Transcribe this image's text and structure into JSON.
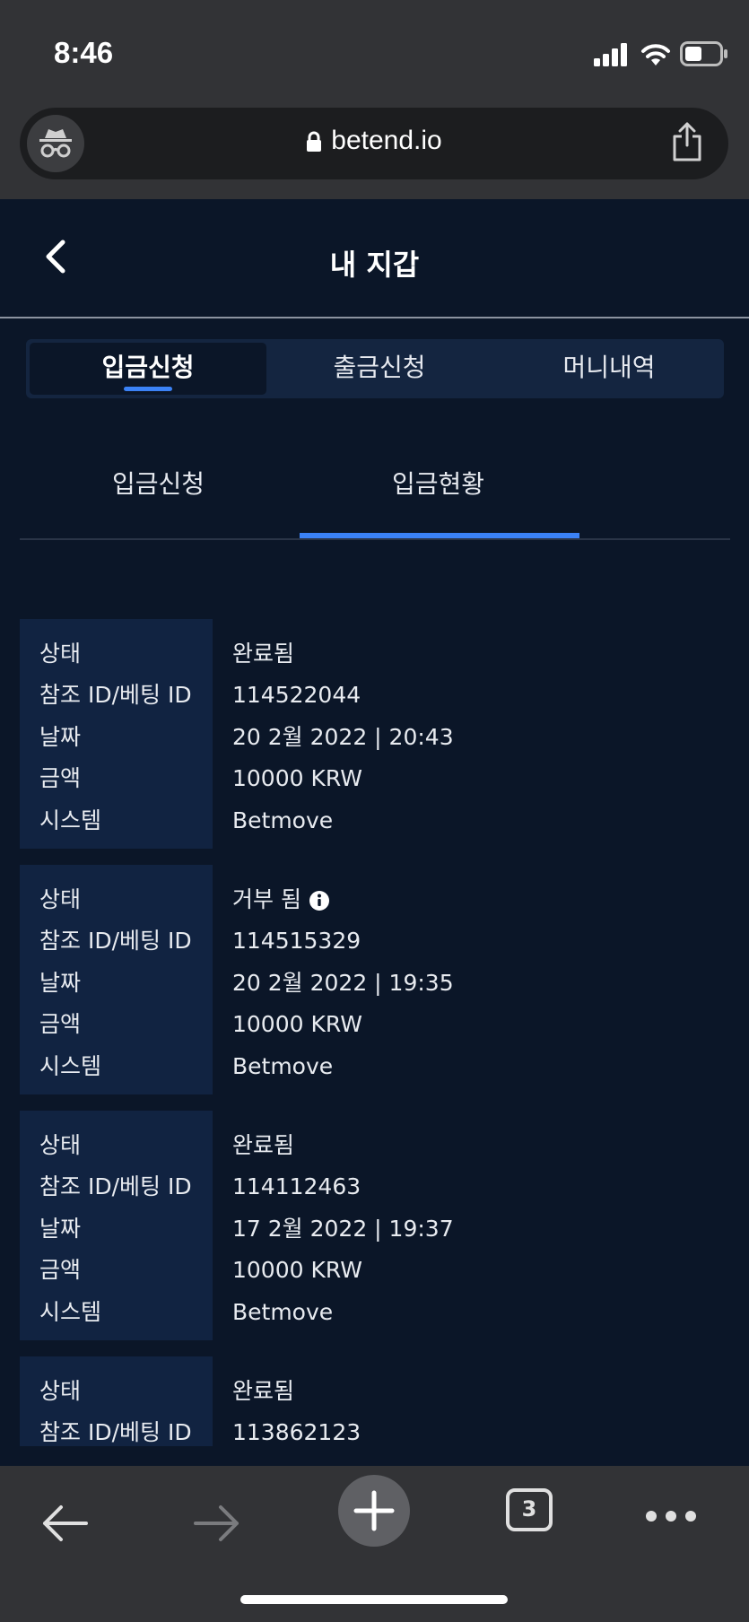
{
  "status_bar": {
    "time": "8:46"
  },
  "browser": {
    "url": "betend.io",
    "tab_count": "3"
  },
  "header": {
    "title": "내 지갑"
  },
  "tabs": [
    {
      "label": "입금신청",
      "active": true
    },
    {
      "label": "출금신청",
      "active": false
    },
    {
      "label": "머니내역",
      "active": false
    }
  ],
  "subtabs": [
    {
      "label": "입금신청",
      "active": false
    },
    {
      "label": "입금현황",
      "active": true
    }
  ],
  "field_labels": {
    "status": "상태",
    "ref_id": "참조 ID/베팅 ID",
    "date": "날짜",
    "amount": "금액",
    "system": "시스템"
  },
  "records": [
    {
      "status": "완료됨",
      "ref_id": "114522044",
      "date": "20 2월 2022 | 20:43",
      "amount": "10000 KRW",
      "system": "Betmove",
      "status_info_icon": false
    },
    {
      "status": "거부 됨",
      "ref_id": "114515329",
      "date": "20 2월 2022 | 19:35",
      "amount": "10000 KRW",
      "system": "Betmove",
      "status_info_icon": true
    },
    {
      "status": "완료됨",
      "ref_id": "114112463",
      "date": "17 2월 2022 | 19:37",
      "amount": "10000 KRW",
      "system": "Betmove",
      "status_info_icon": false
    },
    {
      "status": "완료됨",
      "ref_id": "113862123",
      "date": "",
      "amount": "",
      "system": "",
      "status_info_icon": false
    }
  ],
  "colors": {
    "background": "#0b1628",
    "panel": "#112341",
    "accent": "#3b82f6",
    "browser_chrome": "#323336"
  }
}
